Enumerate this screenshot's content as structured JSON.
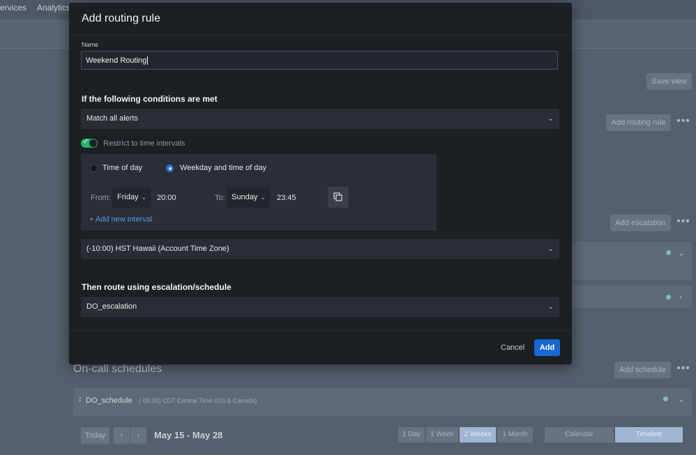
{
  "background": {
    "nav": {
      "services": "ervices",
      "analytics": "Analytics"
    },
    "save_view": "Save view",
    "add_routing_rule": "Add routing rule",
    "add_escalation": "Add escalation",
    "oncall_title": "On-call schedules",
    "add_schedule": "Add schedule",
    "schedule_name": "DO_schedule",
    "schedule_tz": "(-05:00) CDT Central Time (US & Canada)",
    "today": "Today",
    "date_range": "May 15 - May 28",
    "ranges": [
      "1 Day",
      "1 Week",
      "2 Weeks",
      "1 Month"
    ],
    "views": [
      "Calendar",
      "Timeline"
    ],
    "status_color": "#7cc1a8"
  },
  "modal": {
    "title": "Add routing rule",
    "name_label": "Name",
    "name_value": "Weekend Routing",
    "conditions_heading": "If the following conditions are met",
    "match_select": "Match all alerts",
    "restrict_label": "Restrict to time intervals",
    "restrict_enabled": true,
    "radio_time_of_day": "Time of day",
    "radio_weekday": "Weekday and time of day",
    "from_label": "From:",
    "from_day": "Friday",
    "from_time": "20:00",
    "to_label": "To:",
    "to_day": "Sunday",
    "to_time": "23:45",
    "add_interval": "+ Add new interval",
    "timezone": "(-10:00) HST Hawaii (Account Time Zone)",
    "route_heading": "Then route using escalation/schedule",
    "route_select": "DO_escalation",
    "cancel": "Cancel",
    "add": "Add",
    "accent": "#1867d2",
    "toggle_color": "#2bb26a"
  }
}
